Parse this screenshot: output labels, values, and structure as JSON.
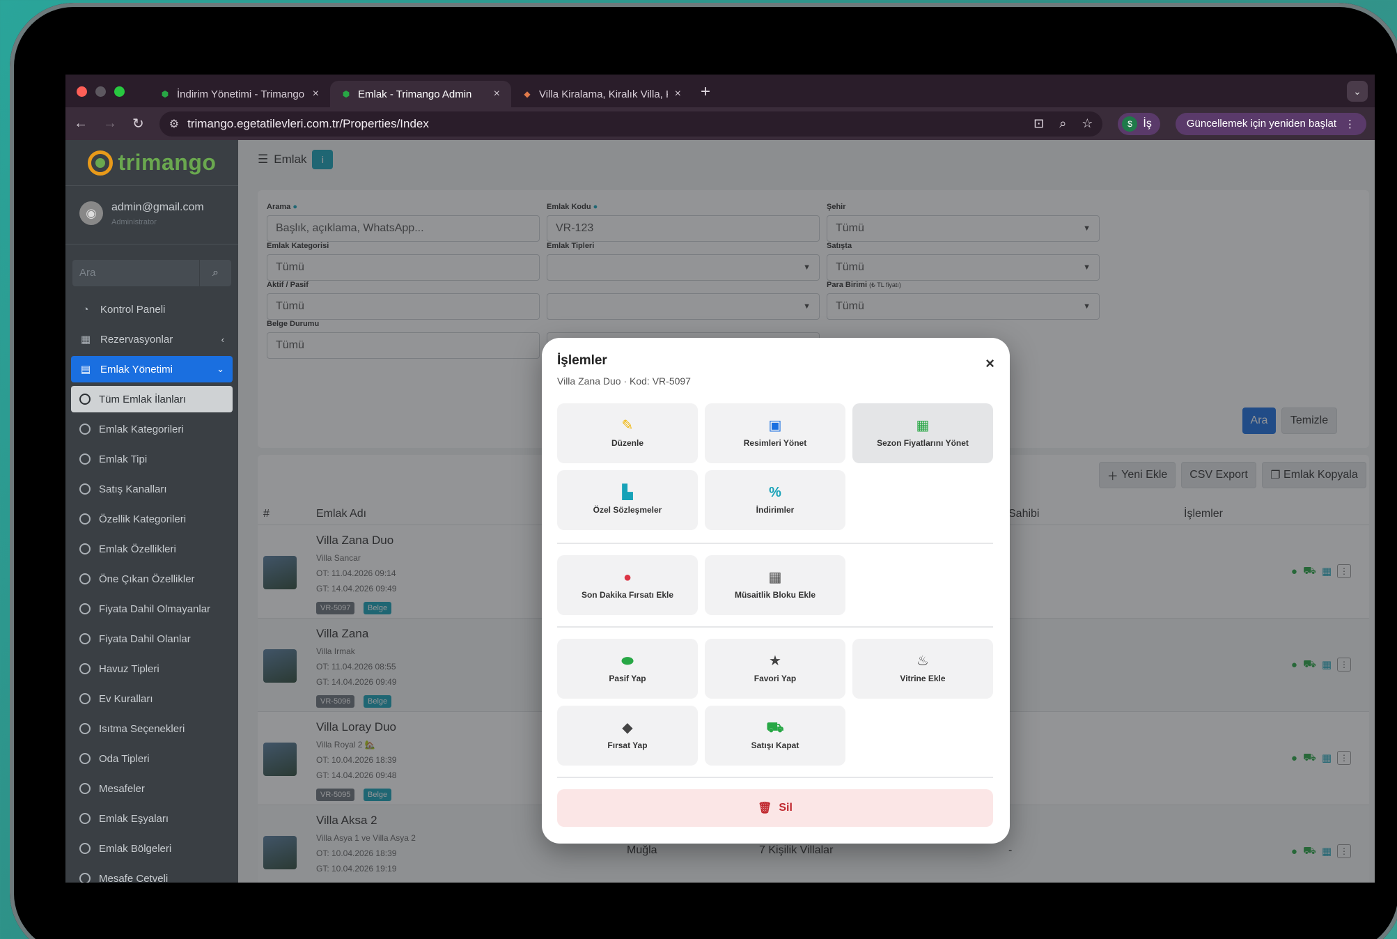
{
  "browser": {
    "tabs": [
      {
        "title": "İndirim Yönetimi - Trimango A"
      },
      {
        "title": "Emlak - Trimango Admin"
      },
      {
        "title": "Villa Kiralama, Kiralık Villa, Ki"
      }
    ],
    "url": "trimango.egetatilevleri.com.tr/Properties/Index",
    "profile": "İş",
    "update_label": "Güncellemek için yeniden başlat"
  },
  "sidebar": {
    "brand": "trimango",
    "user_email": "admin@gmail.com",
    "user_role": "Administrator",
    "search_placeholder": "Ara",
    "items": [
      {
        "label": "Kontrol Paneli"
      },
      {
        "label": "Rezervasyonlar"
      },
      {
        "label": "Emlak Yönetimi"
      }
    ],
    "subitems": [
      {
        "label": "Tüm Emlak İlanları"
      },
      {
        "label": "Emlak Kategorileri"
      },
      {
        "label": "Emlak Tipi"
      },
      {
        "label": "Satış Kanalları"
      },
      {
        "label": "Özellik Kategorileri"
      },
      {
        "label": "Emlak Özellikleri"
      },
      {
        "label": "Öne Çıkan Özellikler"
      },
      {
        "label": "Fiyata Dahil Olmayanlar"
      },
      {
        "label": "Fiyata Dahil Olanlar"
      },
      {
        "label": "Havuz Tipleri"
      },
      {
        "label": "Ev Kuralları"
      },
      {
        "label": "Isıtma Seçenekleri"
      },
      {
        "label": "Oda Tipleri"
      },
      {
        "label": "Mesafeler"
      },
      {
        "label": "Emlak Eşyaları"
      },
      {
        "label": "Emlak Bölgeleri"
      },
      {
        "label": "Mesafe Cetveli"
      }
    ]
  },
  "page": {
    "title": "Emlak",
    "filters": {
      "arama_label": "Arama",
      "arama_placeholder": "Başlık, açıklama, WhatsApp...",
      "kod_label": "Emlak Kodu",
      "kod_placeholder": "VR-123",
      "sehir_label": "Şehir",
      "sehir_value": "Tümü",
      "kategori_label": "Emlak Kategorisi",
      "kategori_value": "Tümü",
      "tipler_label": "Emlak Tipleri",
      "satista_label": "Satışta",
      "satista_value": "Tümü",
      "aktif_label": "Aktif / Pasif",
      "aktif_value": "Tümü",
      "para_label": "Para Birimi",
      "para_note": "(₺ TL fiyatı)",
      "para_value": "Tümü",
      "belge_label": "Belge Durumu",
      "belge_value": "Tümü",
      "search_btn": "Ara",
      "clear_btn": "Temizle"
    },
    "toolbar": {
      "new": "Yeni Ekle",
      "csv": "CSV Export",
      "copy": "Emlak Kopyala"
    },
    "columns": {
      "num": "#",
      "name": "Emlak Adı",
      "owner": "Sahibi",
      "actions": "İşlemler"
    },
    "rows": [
      {
        "name": "Villa Zana Duo",
        "sub": "Villa Sancar",
        "ot": "OT: 11.04.2026 09:14",
        "gt": "GT: 14.04.2026 09:49",
        "code": "VR-5097",
        "doc": "Belge",
        "city": "",
        "type": "",
        "owner": ""
      },
      {
        "name": "Villa Zana",
        "sub": "Villa Irmak",
        "ot": "OT: 11.04.2026 08:55",
        "gt": "GT: 14.04.2026 09:49",
        "code": "VR-5096",
        "doc": "Belge",
        "city": "",
        "type": "",
        "owner": ""
      },
      {
        "name": "Villa Loray Duo",
        "sub": "Villa Royal 2 🏡",
        "ot": "OT: 10.04.2026 18:39",
        "gt": "GT: 14.04.2026 09:48",
        "code": "VR-5095",
        "doc": "Belge",
        "city": "",
        "type": "",
        "owner": ""
      },
      {
        "name": "Villa Aksa 2",
        "sub": "Villa Asya 1 ve Villa Asya 2",
        "ot": "OT: 10.04.2026 18:39",
        "gt": "GT: 10.04.2026 19:19",
        "code": "",
        "doc": "",
        "city": "Muğla",
        "type": "7 Kişilik Villalar",
        "owner": "-"
      }
    ]
  },
  "modal": {
    "title": "İşlemler",
    "subtitle": "Villa Zana Duo · Kod: VR-5097",
    "actions": [
      {
        "label": "Düzenle",
        "icon": "edit-icon"
      },
      {
        "label": "Resimleri Yönet",
        "icon": "images-icon"
      },
      {
        "label": "Sezon Fiyatlarını Yönet",
        "icon": "calendar-icon"
      },
      {
        "label": "Özel Sözleşmeler",
        "icon": "file-contract-icon"
      },
      {
        "label": "İndirimler",
        "icon": "percent-icon"
      },
      {
        "label": "Son Dakika Fırsatı Ekle",
        "icon": "clock-icon"
      },
      {
        "label": "Müsaitlik Bloku Ekle",
        "icon": "calendar-x-icon"
      },
      {
        "label": "Pasif Yap",
        "icon": "toggle-icon"
      },
      {
        "label": "Favori Yap",
        "icon": "star-icon"
      },
      {
        "label": "Vitrine Ekle",
        "icon": "fire-icon"
      },
      {
        "label": "Fırsat Yap",
        "icon": "tag-icon"
      },
      {
        "label": "Satışı Kapat",
        "icon": "cart-icon"
      }
    ],
    "delete_label": "Sil"
  },
  "colors": {
    "primary": "#1a6fe0",
    "success": "#28a745",
    "info": "#17a2b8",
    "danger": "#dc3545",
    "warning": "#f1b400"
  }
}
